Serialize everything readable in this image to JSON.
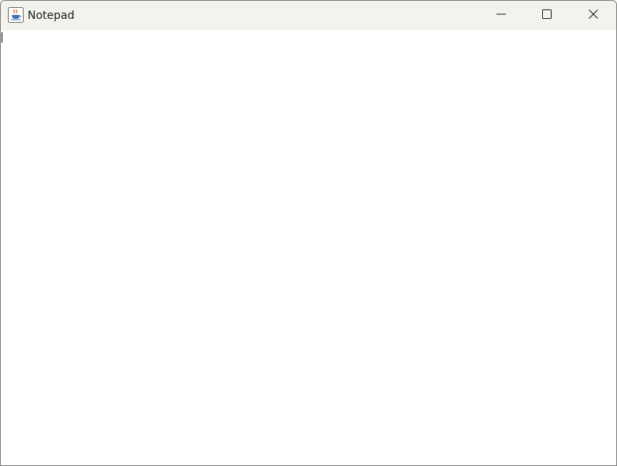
{
  "window": {
    "title": "Notepad",
    "icon": "java-cup-icon",
    "controls": {
      "minimize_icon": "minimize-icon",
      "maximize_icon": "maximize-icon",
      "close_icon": "close-icon"
    }
  },
  "editor": {
    "content": ""
  },
  "colors": {
    "titlebar_bg": "#f3f3ee",
    "editor_bg": "#ffffff",
    "text": "#1a1a1a"
  }
}
